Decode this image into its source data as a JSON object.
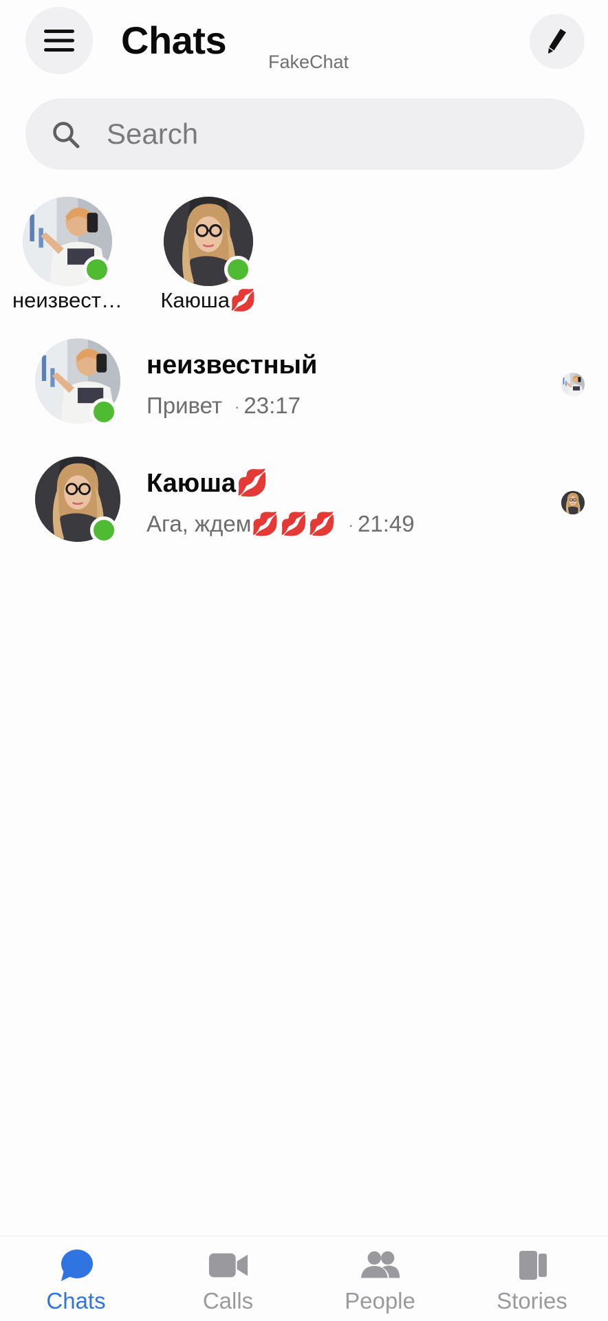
{
  "header": {
    "title": "Chats",
    "app_name": "FakeChat",
    "menu_icon": "hamburger-menu-icon",
    "compose_icon": "pencil-icon"
  },
  "search": {
    "placeholder": "Search",
    "value": "",
    "icon": "search-icon"
  },
  "active_contacts": [
    {
      "name": "неизвест…",
      "online": true,
      "avatar": "avatar-man-white-shirt"
    },
    {
      "name": "Каюша💋",
      "online": true,
      "avatar": "avatar-woman-glasses"
    }
  ],
  "chats": [
    {
      "name": "неизвестный",
      "preview": "Привет",
      "separator": "·",
      "time": "23:17",
      "online": true,
      "avatar": "avatar-man-white-shirt",
      "seen_avatar": "avatar-man-white-shirt"
    },
    {
      "name": "Каюша💋",
      "preview": "Ага, ждем💋💋💋",
      "separator": "·",
      "time": "21:49",
      "online": true,
      "avatar": "avatar-woman-glasses",
      "seen_avatar": "avatar-woman-glasses"
    }
  ],
  "bottom_nav": [
    {
      "label": "Chats",
      "icon": "chat-bubble-icon",
      "active": true
    },
    {
      "label": "Calls",
      "icon": "video-camera-icon",
      "active": false
    },
    {
      "label": "People",
      "icon": "people-icon",
      "active": false
    },
    {
      "label": "Stories",
      "icon": "stories-icon",
      "active": false
    }
  ],
  "colors": {
    "accent": "#2f74e0",
    "online": "#4ebb33",
    "inactive_nav": "#9a9a9e",
    "lips": "#e23b3b"
  }
}
